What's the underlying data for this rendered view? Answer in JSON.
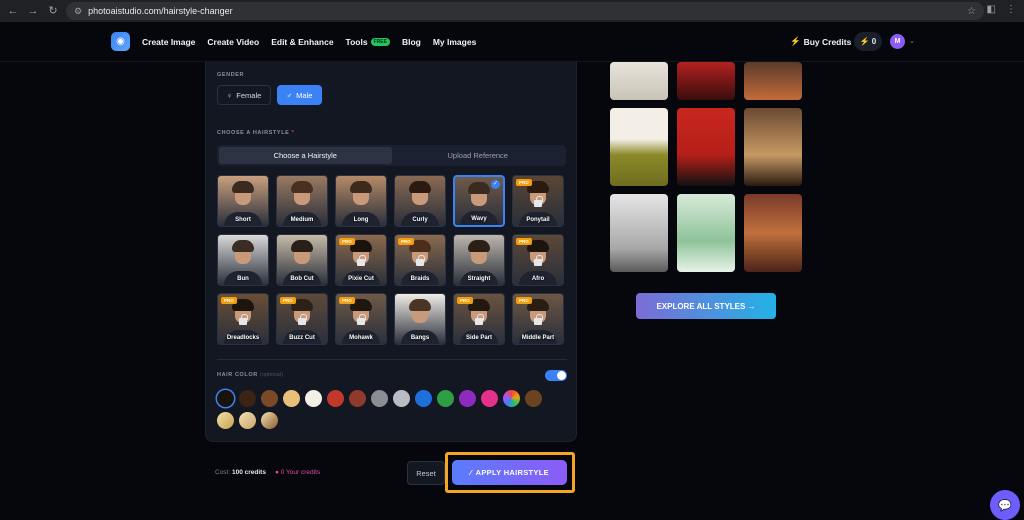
{
  "browser": {
    "url": "photoaistudio.com/hairstyle-changer"
  },
  "header": {
    "menu": [
      {
        "label": "Create Image"
      },
      {
        "label": "Create Video"
      },
      {
        "label": "Edit & Enhance"
      },
      {
        "label": "Tools",
        "badge": "FREE"
      },
      {
        "label": "Blog"
      },
      {
        "label": "My Images"
      }
    ],
    "buy_credits": "Buy Credits",
    "credits": "0",
    "avatar_initial": "M"
  },
  "gender": {
    "label": "GENDER",
    "options": [
      "Female",
      "Male"
    ],
    "selected": "Male"
  },
  "hairstyle": {
    "label": "CHOOSE A HAIRSTYLE",
    "required_mark": "*",
    "tabs": [
      "Choose a Hairstyle",
      "Upload Reference"
    ],
    "active_tab": "Choose a Hairstyle",
    "pro_label": "PRO",
    "check_mark": "✓",
    "items": [
      {
        "name": "Short",
        "pro": false
      },
      {
        "name": "Medium",
        "pro": false
      },
      {
        "name": "Long",
        "pro": false
      },
      {
        "name": "Curly",
        "pro": false
      },
      {
        "name": "Wavy",
        "pro": false,
        "selected": true
      },
      {
        "name": "Ponytail",
        "pro": true
      },
      {
        "name": "Bun",
        "pro": false
      },
      {
        "name": "Bob Cut",
        "pro": false
      },
      {
        "name": "Pixie Cut",
        "pro": true
      },
      {
        "name": "Braids",
        "pro": true
      },
      {
        "name": "Straight",
        "pro": false
      },
      {
        "name": "Afro",
        "pro": true
      },
      {
        "name": "Dreadlocks",
        "pro": true
      },
      {
        "name": "Buzz Cut",
        "pro": true
      },
      {
        "name": "Mohawk",
        "pro": true
      },
      {
        "name": "Bangs",
        "pro": false
      },
      {
        "name": "Side Part",
        "pro": true
      },
      {
        "name": "Middle Part",
        "pro": true
      }
    ]
  },
  "hair_color": {
    "label": "HAIR COLOR",
    "optional": "(optional)",
    "enabled": true,
    "swatches": [
      "#1a120d",
      "#3b2414",
      "#7a4a26",
      "#e8c07a",
      "#f3efe6",
      "#c0392b",
      "#8e3b2b",
      "#8a8d93",
      "#b9bcc2",
      "#1e6fd9",
      "#2e9e44",
      "#8e2bbf",
      "#e5318a",
      "rainbow",
      "#6b4323",
      "#c9a04a",
      "#c9a56a",
      "#8a5a32"
    ]
  },
  "footer": {
    "cost_prefix": "Cost:",
    "cost_value": "100 credits",
    "your_credits": "0 Your credits",
    "reset": "Reset",
    "apply": "APPLY HAIRSTYLE"
  },
  "gallery": {
    "explore": "EXPLORE ALL STYLES →"
  }
}
